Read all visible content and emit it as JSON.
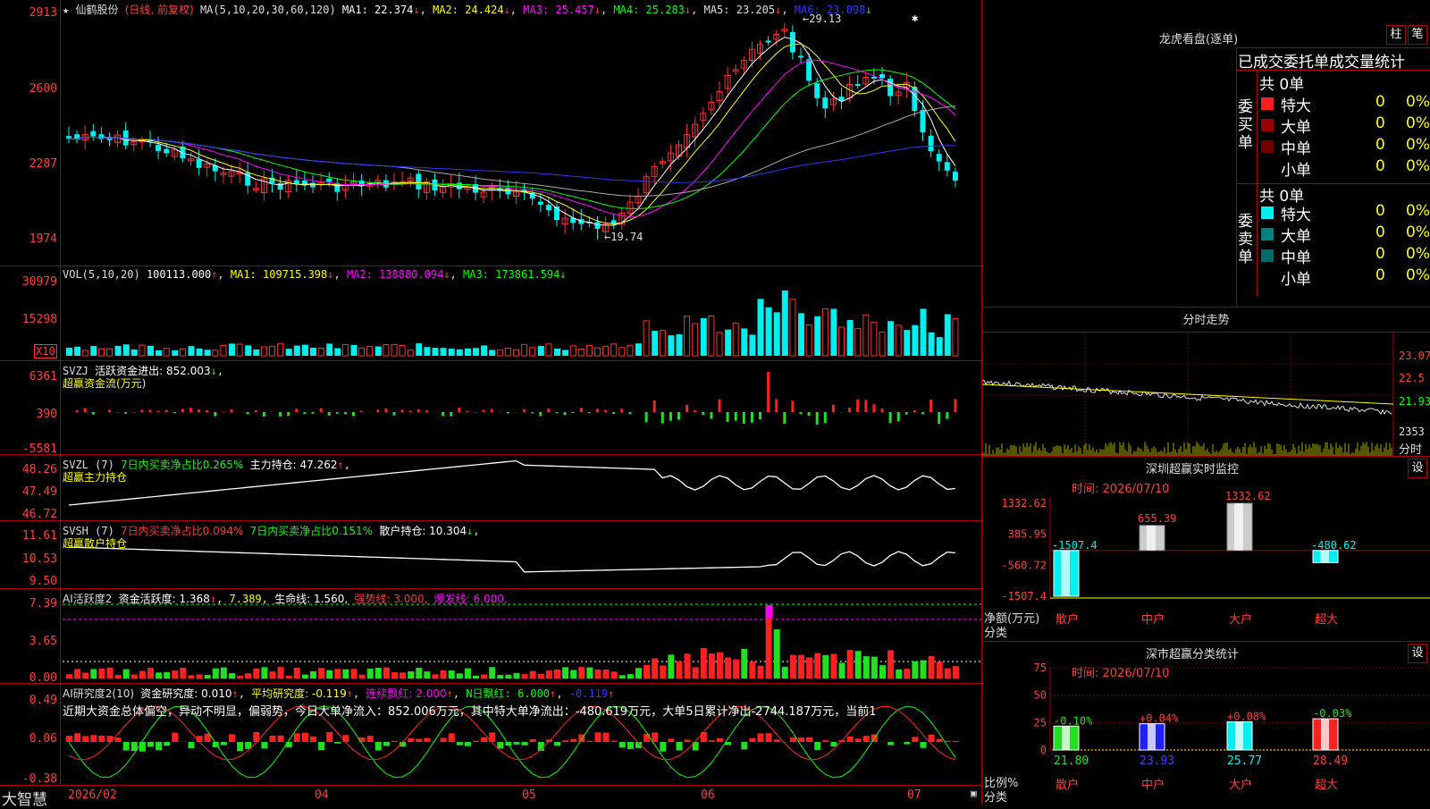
{
  "stock": {
    "name": "仙鹤股份",
    "mode": "(日线, 前复权)",
    "ma_label": "MA(5,10,20,30,60,120)",
    "ma1": "MA1: 22.374",
    "ma2": "MA2: 24.424",
    "ma3": "MA3: 25.457",
    "ma4": "MA4: 25.283",
    "ma5": "MA5: 23.205",
    "ma6": "MA6: 23.098",
    "high_mark": "29.13",
    "low_mark": "19.74"
  },
  "price_axis": [
    "2913",
    "2600",
    "2287",
    "1974"
  ],
  "vol": {
    "label": "VOL(5,10,20)",
    "value": "100113.000",
    "ma1": "MA1: 109715.398",
    "ma2": "MA2: 138880.094",
    "ma3": "MA3: 173861.594",
    "axis": [
      "30979",
      "15298"
    ],
    "unit": "X10"
  },
  "svzj": {
    "label": "SVZJ",
    "text": "活跃资金进出: 852.003",
    "sub": "超赢资金流(万元)",
    "axis": [
      "6361",
      "390",
      "-5581"
    ]
  },
  "svzl": {
    "label": "SVZL (7)",
    "t1": "7日内买卖净占比0.265%",
    "t2": "主力持仓: 47.262",
    "sub": "超赢主力持仓",
    "axis": [
      "48.26",
      "47.49",
      "46.72"
    ]
  },
  "svsh": {
    "label": "SVSH (7)",
    "t1": "7日内买卖净占比0.094%",
    "t2": "7日内买卖净占比0.151%",
    "t3": "散户持仓: 10.304",
    "sub": "超赢散户持仓",
    "axis": [
      "11.61",
      "10.53",
      "9.50"
    ]
  },
  "ai1": {
    "label": "AI活跃度2",
    "t1": "资金活跃度: 1.368",
    "t2": "7.389,",
    "t3": "生命线: 1.560,",
    "t4": "强势线: 3.000,",
    "t5": "爆发线: 6.000,",
    "axis": [
      "7.39",
      "3.65",
      "0.00"
    ]
  },
  "ai2": {
    "label": "AI研究度2(10)",
    "t1": "资金研究度: 0.010",
    "t2": "平均研究度: -0.119",
    "t3": "连续飘红: 2.000",
    "t4": "N日飘红: 6.000",
    "t5": "-0.119",
    "comment": "近期大资金总体偏空，异动不明显，偏弱势，今日大单净流入：852.006万元，其中特大单净流出：-480.619万元，大单5日累计净出-2744.187万元，当前1",
    "axis": [
      "0.49",
      "0.06",
      "-0.38"
    ]
  },
  "xaxis": [
    "2026/02",
    "04",
    "05",
    "06",
    "07"
  ],
  "brand": "大智慧",
  "lhb": {
    "title": "龙虎看盘(逐单)",
    "btn1": "柱",
    "btn2": "笔",
    "header": "已成交委托单成交量统计",
    "buy": {
      "side": "委买单",
      "count": "共 0单",
      "rows": [
        {
          "name": "特大",
          "v": "0",
          "p": "0%",
          "color": "#ff1e1e"
        },
        {
          "name": "大单",
          "v": "0",
          "p": "0%",
          "color": "#9a0000"
        },
        {
          "name": "中单",
          "v": "0",
          "p": "0%",
          "color": "#700000"
        },
        {
          "name": "小单",
          "v": "0",
          "p": "0%",
          "color": "#000"
        }
      ]
    },
    "sell": {
      "side": "委卖单",
      "count": "共 0单",
      "rows": [
        {
          "name": "特大",
          "v": "0",
          "p": "0%",
          "color": "#00f0f0"
        },
        {
          "name": "大单",
          "v": "0",
          "p": "0%",
          "color": "#008080"
        },
        {
          "name": "中单",
          "v": "0",
          "p": "0%",
          "color": "#006a6a"
        },
        {
          "name": "小单",
          "v": "0",
          "p": "0%",
          "color": "#000"
        }
      ]
    }
  },
  "fenshi": {
    "title": "分时走势",
    "axis": [
      "23.07",
      "22.5",
      "21.93",
      "2353"
    ],
    "xlabel": "分时"
  },
  "monitor": {
    "title": "深圳超赢实时监控",
    "btn": "设",
    "time": "时间: 2026/07/10",
    "axis": [
      "1332.62",
      "385.95",
      "-560.72",
      "-1507.4"
    ],
    "ylabel": "净额(万元)",
    "xlabel": "分类",
    "cats": [
      "散户",
      "中户",
      "大户",
      "超大"
    ],
    "values": [
      -1507.4,
      655.39,
      1332.62,
      -480.62
    ],
    "labels": [
      "-1507.4",
      "655.39",
      "1332.62",
      "-480.62"
    ]
  },
  "stats": {
    "title": "深市超赢分类统计",
    "btn": "设",
    "time": "时间: 2026/07/10",
    "axis": [
      "75",
      "50",
      "25",
      "0"
    ],
    "ylabel": "比例%",
    "xlabel": "分类",
    "cats": [
      "散户",
      "中户",
      "大户",
      "超大"
    ],
    "values": [
      21.8,
      23.93,
      25.77,
      28.49
    ],
    "changes": [
      "-0.10%",
      "+0.04%",
      "+0.08%",
      "-0.03%"
    ],
    "labels": [
      "21.80",
      "23.93",
      "25.77",
      "28.49"
    ]
  }
}
